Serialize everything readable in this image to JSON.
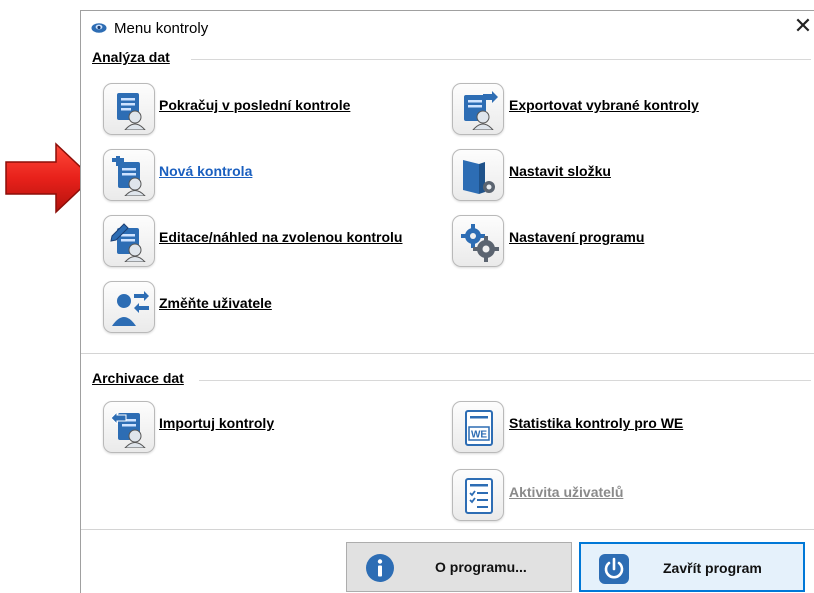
{
  "window": {
    "title": "Menu kontroly",
    "close_glyph": "✕"
  },
  "sections": {
    "analysis": {
      "title": "Analýza dat"
    },
    "archive": {
      "title": "Archivace dat"
    }
  },
  "actions": {
    "continue_last": "Pokračuj v poslední kontrole",
    "new_check": "Nová kontrola",
    "edit_preview": "Editace/náhled na zvolenou kontrolu",
    "change_user": "Změňte uživatele",
    "export_selected": "Exportovat vybrané kontroly",
    "set_folder": "Nastavit složku",
    "program_settings": "Nastavení programu",
    "import_checks": "Importuj kontroly",
    "statistics_we": "Statistika kontroly pro WE",
    "user_activity": "Aktivita uživatelů",
    "we_badge": "WE"
  },
  "footer": {
    "about": "O programu...",
    "close_program": "Zavřít program"
  },
  "colors": {
    "accent": "#0078d7",
    "icon_blue": "#2d6db4",
    "link_active": "#1a5fbf",
    "disabled": "#8a8a8a",
    "arrow_red": "#e8211b"
  },
  "icons": {
    "app": "eye-icon",
    "arrow": "red-pointer-arrow-icon"
  }
}
